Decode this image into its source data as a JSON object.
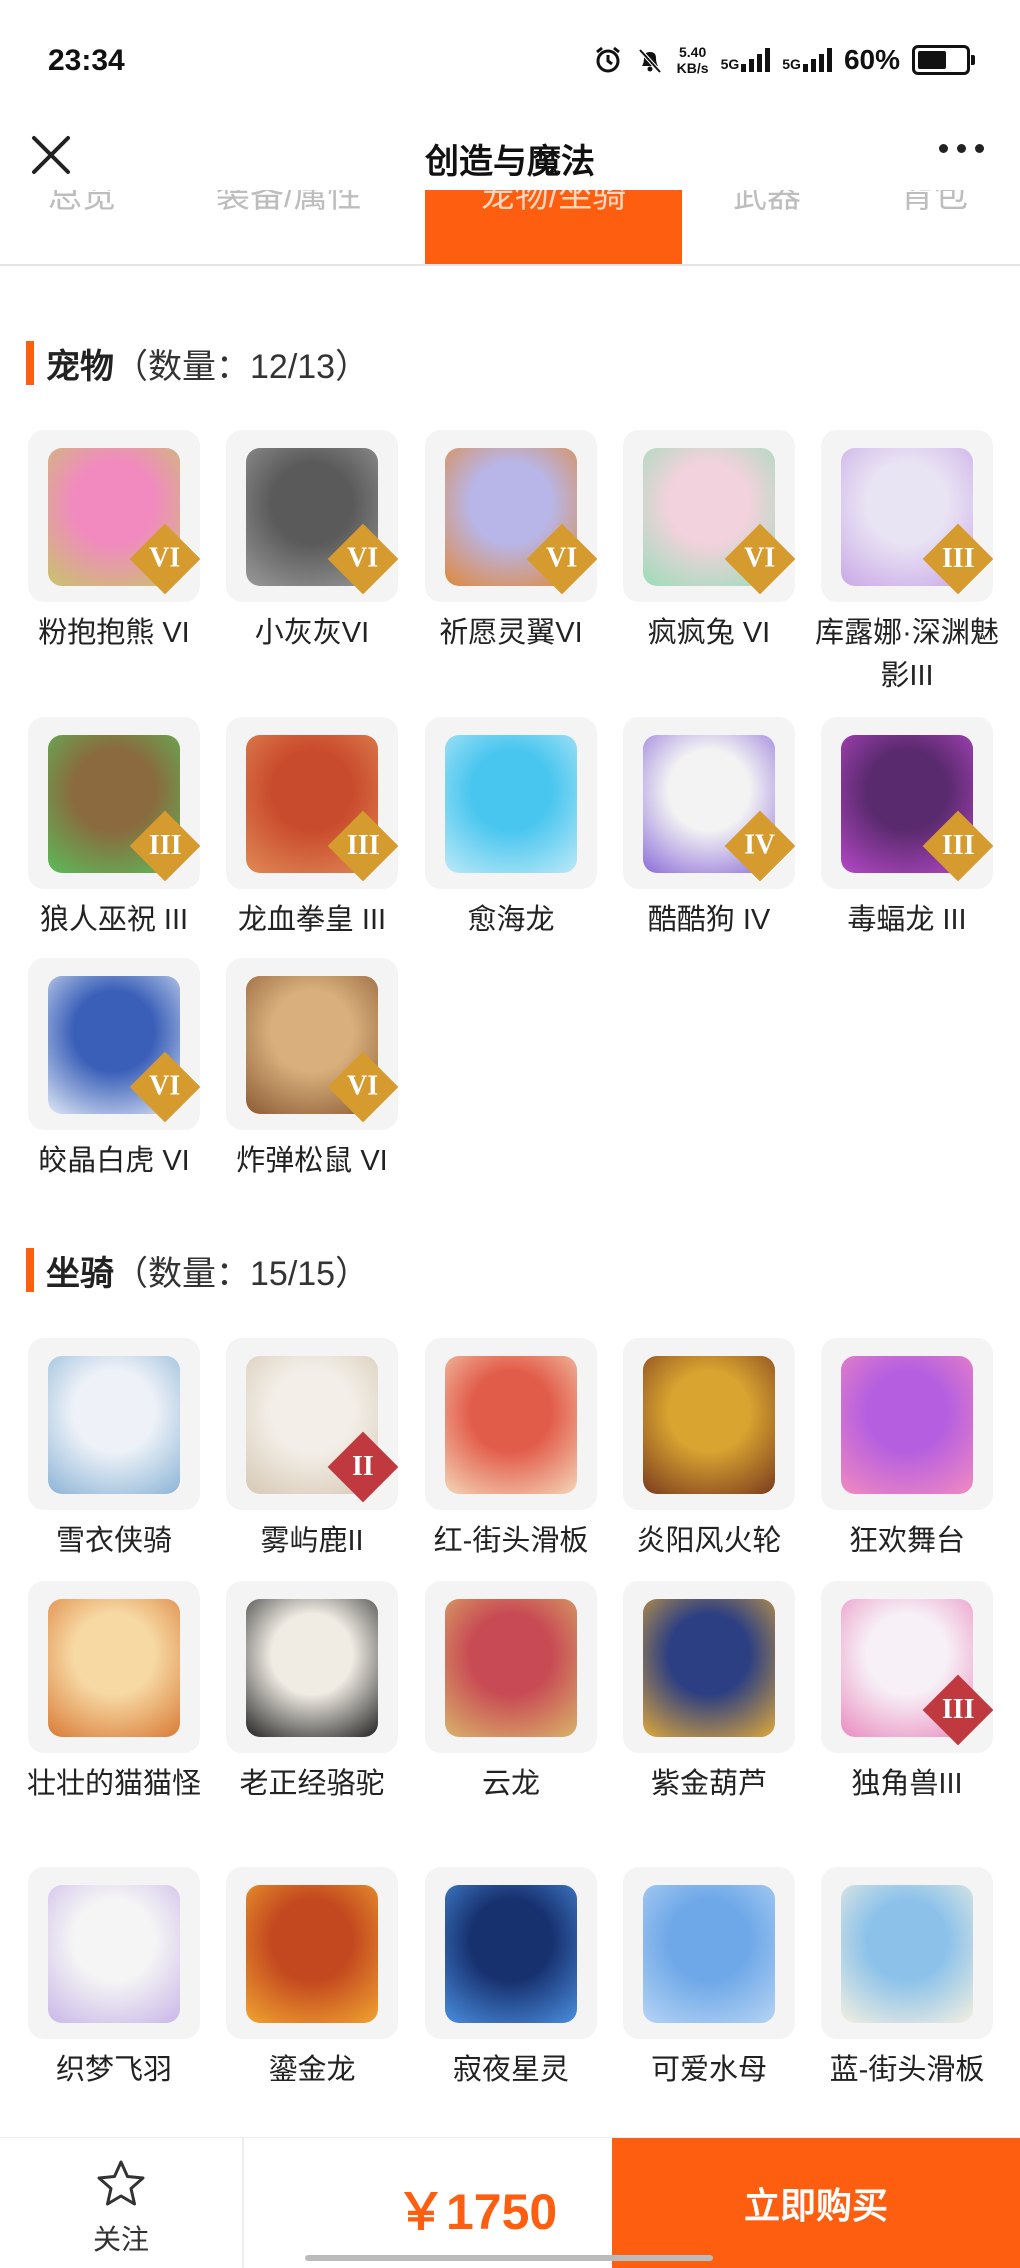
{
  "status": {
    "time": "23:34",
    "net_speed_value": "5.40",
    "net_speed_unit": "KB/s",
    "sim1": "5G",
    "sim2": "5G",
    "battery": "60%",
    "battery_level": 0.6
  },
  "nav": {
    "title": "创造与魔法"
  },
  "tabs": [
    "总览",
    "装备/属性",
    "宠物/坐骑",
    "武器",
    "背包"
  ],
  "pets": {
    "title": "宠物",
    "count": "（数量：12/13）",
    "items": [
      {
        "label": "粉抱抱熊 VI",
        "badge": "VI",
        "badge_color": "#d59b2e",
        "art": [
          "#f28ac0",
          "#c7c46a"
        ]
      },
      {
        "label": "小灰灰VI",
        "badge": "VI",
        "badge_color": "#d59b2e",
        "art": [
          "#5a5a5a",
          "#9a9a9a"
        ]
      },
      {
        "label": "祈愿灵翼VI",
        "badge": "VI",
        "badge_color": "#d59b2e",
        "art": [
          "#b8b6e8",
          "#e0883a"
        ]
      },
      {
        "label": "疯疯兔 VI",
        "badge": "VI",
        "badge_color": "#d59b2e",
        "art": [
          "#f2d2dc",
          "#9bdcb8"
        ]
      },
      {
        "label": "库露娜·深渊魅影III",
        "badge": "III",
        "badge_color": "#d59b2e",
        "art": [
          "#e9e4f4",
          "#c9a7e6"
        ]
      },
      {
        "label": "狼人巫祝 III",
        "badge": "III",
        "badge_color": "#d59b2e",
        "art": [
          "#8a6a3e",
          "#5bbd5a"
        ]
      },
      {
        "label": "龙血拳皇 III",
        "badge": "III",
        "badge_color": "#d59b2e",
        "art": [
          "#c94b2d",
          "#e08a56"
        ]
      },
      {
        "label": "愈海龙",
        "badge": "",
        "badge_color": "",
        "art": [
          "#49c6ef",
          "#bde9f8"
        ]
      },
      {
        "label": "酷酷狗 IV",
        "badge": "IV",
        "badge_color": "#d59b2e",
        "art": [
          "#f3f3f3",
          "#8b6cd9"
        ]
      },
      {
        "label": "毒蝠龙 III",
        "badge": "III",
        "badge_color": "#d59b2e",
        "art": [
          "#5a2a6e",
          "#b648c8"
        ]
      },
      {
        "label": "皎晶白虎 VI",
        "badge": "VI",
        "badge_color": "#d59b2e",
        "art": [
          "#3a5fb8",
          "#dfe8f6"
        ]
      },
      {
        "label": "炸弹松鼠 VI",
        "badge": "VI",
        "badge_color": "#d59b2e",
        "art": [
          "#d9b07d",
          "#8a5b34"
        ]
      }
    ]
  },
  "mounts": {
    "title": "坐骑",
    "count": "（数量：15/15）",
    "items": [
      {
        "label": "雪衣侠骑",
        "badge": "",
        "badge_color": "",
        "art": [
          "#eef2f8",
          "#8bb4d6"
        ]
      },
      {
        "label": "雾屿鹿II",
        "badge": "II",
        "badge_color": "#c0393f",
        "art": [
          "#f3efe8",
          "#d6c8b4"
        ]
      },
      {
        "label": "红-街头滑板",
        "badge": "",
        "badge_color": "",
        "art": [
          "#e25c4a",
          "#f4d6b8"
        ]
      },
      {
        "label": "炎阳风火轮",
        "badge": "",
        "badge_color": "",
        "art": [
          "#d9a430",
          "#7a3b1f"
        ]
      },
      {
        "label": "狂欢舞台",
        "badge": "",
        "badge_color": "",
        "art": [
          "#b55fe0",
          "#f28ac0"
        ]
      },
      {
        "label": "壮壮的猫猫怪",
        "badge": "",
        "badge_color": "",
        "art": [
          "#f7d9a4",
          "#d97a35"
        ]
      },
      {
        "label": "老正经骆驼",
        "badge": "",
        "badge_color": "",
        "art": [
          "#f0ece4",
          "#222222"
        ]
      },
      {
        "label": "云龙",
        "badge": "",
        "badge_color": "",
        "art": [
          "#c84a54",
          "#d9b46a"
        ]
      },
      {
        "label": "紫金葫芦",
        "badge": "",
        "badge_color": "",
        "art": [
          "#2c3f82",
          "#e0a93a"
        ]
      },
      {
        "label": "独角兽III",
        "badge": "III",
        "badge_color": "#c0393f",
        "art": [
          "#f7f0f6",
          "#e98bc0"
        ]
      },
      {
        "label": "织梦飞羽",
        "badge": "",
        "badge_color": "",
        "art": [
          "#f5f5f5",
          "#c9b6e8"
        ]
      },
      {
        "label": "鎏金龙",
        "badge": "",
        "badge_color": "",
        "art": [
          "#c3481f",
          "#f0a530"
        ]
      },
      {
        "label": "寂夜星灵",
        "badge": "",
        "badge_color": "",
        "art": [
          "#17306e",
          "#4a8fe0"
        ]
      },
      {
        "label": "可爱水母",
        "badge": "",
        "badge_color": "",
        "art": [
          "#6ea8e8",
          "#b6d4f4"
        ]
      },
      {
        "label": "蓝-街头滑板",
        "badge": "",
        "badge_color": "",
        "art": [
          "#8cc2ea",
          "#f4f0e0"
        ]
      }
    ]
  },
  "bottom": {
    "follow_label": "关注",
    "price": "￥1750",
    "buy_label": "立即购买"
  }
}
